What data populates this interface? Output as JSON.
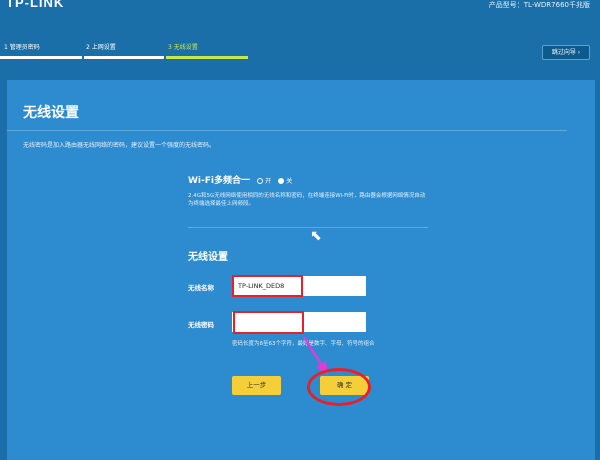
{
  "header": {
    "logo": "TP-LINK",
    "model": "产品型号：TL-WDR7660千兆版"
  },
  "steps": [
    {
      "label": "1 管理员密码",
      "state": "done"
    },
    {
      "label": "2 上网设置",
      "state": "done"
    },
    {
      "label": "3 无线设置",
      "state": "active"
    }
  ],
  "skip_label": "跳过向导 ›",
  "panel": {
    "title": "无线设置",
    "description": "无线密码是加入路由器无线网络的密码，建议设置一个强度的无线密码。"
  },
  "wifi": {
    "label": "Wi-Fi多频合一",
    "on_label": "开",
    "off_label": "关",
    "selected": "off",
    "description": "2.4G和5G无线网络使用相同的无线名称和密码，在终端连接Wi-Fi时，路由器会根据网络情况自动为终端选择最佳上网频段。"
  },
  "wireless": {
    "title": "无线设置",
    "name_label": "无线名称",
    "name_value": "TP-LINK_DED8",
    "password_label": "无线密码",
    "password_value": "",
    "hint": "密码长度为8至63个字符，最好是数字、字母、符号的组合"
  },
  "buttons": {
    "prev": "上一步",
    "ok": "确 定"
  },
  "colors": {
    "background": "#1a6fa8",
    "panel": "#2d8bd0",
    "button": "#f4cf3a",
    "active_step": "#c7e84a",
    "annotation": "#e8202a",
    "arrow": "#e23ad8"
  }
}
